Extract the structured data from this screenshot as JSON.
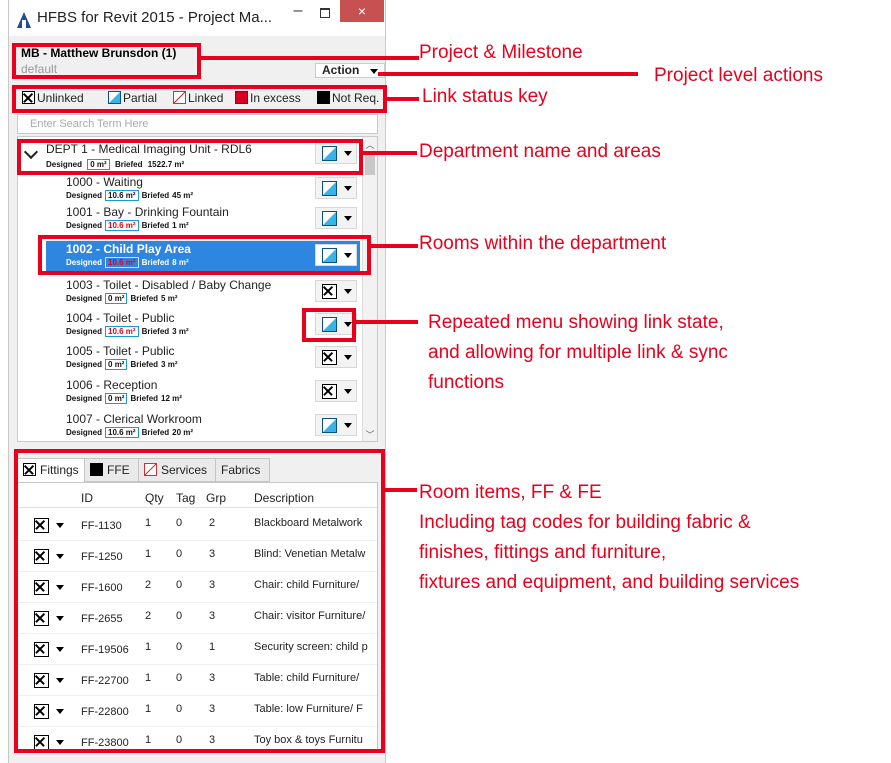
{
  "window": {
    "title": "HFBS for Revit 2015 - Project Ma...",
    "minimize": "–",
    "close": "×"
  },
  "project": {
    "name": "MB - Matthew Brunsdon (1)",
    "milestone": "default",
    "action_label": "Action"
  },
  "key": {
    "unlinked": "Unlinked",
    "partial": "Partial",
    "linked": "Linked",
    "excess": "In excess",
    "not_required": "Not Req."
  },
  "search": {
    "placeholder": "Enter Search Term Here"
  },
  "metric_labels": {
    "designed": "Designed",
    "briefed": "Briefed"
  },
  "department": {
    "name": "DEPT 1  -  Medical Imaging Unit - RDL6",
    "designed": "0 m²",
    "briefed": "1522.7 m²",
    "status": "partial"
  },
  "rooms": [
    {
      "title": "1000  -  Waiting",
      "designed": "10.6 m²",
      "briefed": "45 m²",
      "status": "partial",
      "excess": false
    },
    {
      "title": "1001  -  Bay - Drinking Fountain",
      "designed": "10.6 m²",
      "briefed": "1 m²",
      "status": "partial",
      "excess": true
    },
    {
      "title": "1002  -  Child Play Area",
      "designed": "10.6 m²",
      "briefed": "8 m²",
      "status": "partial",
      "excess": true
    },
    {
      "title": "1003  -  Toilet - Disabled / Baby Change",
      "designed": "0 m²",
      "briefed": "5 m²",
      "status": "unlinked",
      "excess": false
    },
    {
      "title": "1004  -  Toilet - Public",
      "designed": "10.6 m²",
      "briefed": "3 m²",
      "status": "partial",
      "excess": true
    },
    {
      "title": "1005  -  Toilet - Public",
      "designed": "0 m²",
      "briefed": "3 m²",
      "status": "unlinked",
      "excess": false
    },
    {
      "title": "1006  -  Reception",
      "designed": "0 m²",
      "briefed": "12 m²",
      "status": "unlinked",
      "excess": false
    },
    {
      "title": "1007  -  Clerical Workroom",
      "designed": "10.6 m²",
      "briefed": "20 m²",
      "status": "partial",
      "excess": false
    }
  ],
  "tabs": [
    "Fittings",
    "FFE",
    "Services",
    "Fabrics"
  ],
  "columns": [
    "ID",
    "Qty",
    "Tag",
    "Grp",
    "Description"
  ],
  "items": [
    {
      "id": "FF-1130",
      "qty": "1",
      "tag": "0",
      "grp": "2",
      "desc": "Blackboard Metalwork"
    },
    {
      "id": "FF-1250",
      "qty": "1",
      "tag": "0",
      "grp": "3",
      "desc": "Blind: Venetian Metalw"
    },
    {
      "id": "FF-1600",
      "qty": "2",
      "tag": "0",
      "grp": "3",
      "desc": "Chair: child Furniture/"
    },
    {
      "id": "FF-2655",
      "qty": "2",
      "tag": "0",
      "grp": "3",
      "desc": "Chair: visitor Furniture/"
    },
    {
      "id": "FF-19506",
      "qty": "1",
      "tag": "0",
      "grp": "1",
      "desc": "Security screen: child p"
    },
    {
      "id": "FF-22700",
      "qty": "1",
      "tag": "0",
      "grp": "3",
      "desc": "Table: child Furniture/"
    },
    {
      "id": "FF-22800",
      "qty": "1",
      "tag": "0",
      "grp": "3",
      "desc": "Table: low Furniture/ F"
    },
    {
      "id": "FF-23800",
      "qty": "1",
      "tag": "0",
      "grp": "3",
      "desc": "Toy box & toys Furnitu"
    }
  ],
  "callouts": {
    "project_milestone": "Project & Milestone",
    "project_actions": "Project level actions",
    "link_key": "Link status key",
    "department": "Department name and areas",
    "rooms": "Rooms within the department",
    "menu_line1": "Repeated menu showing link state,",
    "menu_line2": "and allowing for multiple link & sync",
    "menu_line3": "functions",
    "items_line1": "Room items, FF & FE",
    "items_line2": "Including tag codes for building fabric &",
    "items_line3": "finishes, fittings and furniture,",
    "items_line4": "fixtures and equipment, and building services"
  },
  "colors": {
    "annotation": "#e8001c",
    "selection": "#2f86e0",
    "partial": "#3ab4e6",
    "excess": "#e2001a"
  }
}
